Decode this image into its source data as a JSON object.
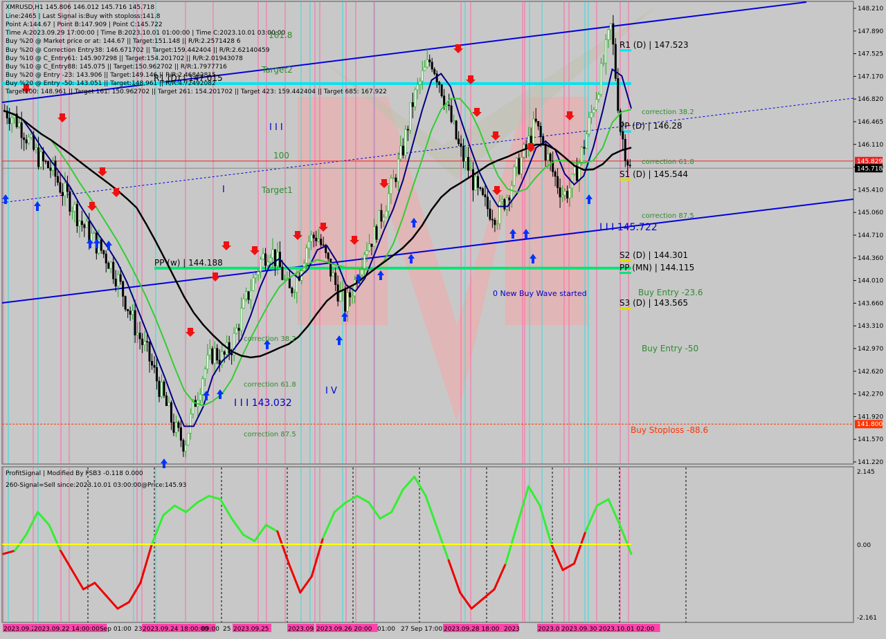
{
  "header": {
    "lines": [
      "XMRUSD,H1  145.806 146.012 145.716 145.718",
      "Line:2465 | Last Signal is:Buy with stoploss:141.8",
      "Point A:144.67 | Point B:147.909 | Point C:145.722",
      "Time A:2023.09.29 17:00:00 | Time B:2023.10.01 01:00:00 | Time C:2023.10.01 03:00:00",
      "Buy %20 @ Market price or at: 144.67 || Target:151.148 || R/R:2.2571428 6",
      "Buy %20 @ Correction Entry38: 146.671702 || Target:159.442404 || R/R:2.62140459",
      "Buy %10 @ C_Entry61: 145.907298 || Target:154.201702 || R/R:2.01943078",
      "Buy %10 @ C_Entry88: 145.075 || Target:150.962702 || R/R:1.7977716",
      "Buy %20 @ Entry -23: 143.906 || Target:149.146 || R/R:2.46842815",
      "Buy %20 @ Entry -50: 143.051 || Target:148.961 || R/R:4.72492082",
      "Target100: 148.961 || Target 161: 150.962702 || Target 261: 154.201702 || Target 423: 159.442404 || Target 685: 167.922"
    ]
  },
  "colors": {
    "background": "#c8c8c8",
    "bull_candle": "#22aa22",
    "trend_channel": "#0000dd",
    "level_cyan": "#00e5ee",
    "pivot_green": "#00e676",
    "ma_fast": "#000080",
    "ma_green": "#33cc33",
    "ma_black": "#000000",
    "stoploss": "#ff3300",
    "osc_up": "#33ee33",
    "osc_down": "#ee0000",
    "zero_line": "#ffff00",
    "vline_magenta": "#ff66aa",
    "vline_cyan": "#33dddd"
  },
  "price_axis": {
    "ticks": [
      "148.210",
      "147.890",
      "147.525",
      "147.170",
      "146.820",
      "146.465",
      "146.110",
      "145.760",
      "145.410",
      "145.060",
      "144.710",
      "144.360",
      "144.010",
      "143.660",
      "143.310",
      "142.970",
      "142.620",
      "142.270",
      "141.920",
      "141.570",
      "141.220"
    ],
    "current_price_label": "145.718",
    "red_line_label": "145.829",
    "stoploss_label": "141.800"
  },
  "annotations": {
    "fib_161": "161.8",
    "target2": "Target2",
    "fib_100": "100",
    "target1": "Target1",
    "wave_iii": "I I I",
    "wave_i": "I",
    "wave_iv": "I V",
    "wave_iii_price": "I I I 143.032",
    "wave_iii_price_2": "I I I 145.722",
    "pp_w": "PP (w) | 144.188",
    "r1_d": "R1 (D) | 147.523",
    "pp_d": "PP (D) | 146.28",
    "s1_d": "S1 (D) | 145.544",
    "s2_d": "S2 (D) | 144.301",
    "pp_mn": "PP (MN) | 144.115",
    "s3_d": "S3 (D) | 143.565",
    "corr_38_top": "correction 38.2",
    "corr_61_top": "correction 61.8",
    "corr_87_top": "correction 87.5",
    "corr_38_bot": "correction 38.2",
    "corr_61_bot": "correction 61.8",
    "corr_87_bot": "correction 87.5",
    "buy_entry_23": "Buy Entry -23.6",
    "buy_entry_50": "Buy Entry -50",
    "buy_stoploss": "Buy Stoploss -88.6",
    "new_wave": "0 New Buy Wave started",
    "r1_short": "R1 (D) | 147.015"
  },
  "oscillator": {
    "title": "ProfitSignal | Modified By FSB3 -0.118 0.000",
    "subtitle": "260-Signal=Sell since:2023.10.01 03:00:00@Price:145.93",
    "axis_top": "2.145",
    "axis_zero": "0.00",
    "axis_bottom": "-2.161"
  },
  "time_axis": {
    "labels": [
      "2023.09.22",
      "2023.09.22 14:00:00",
      "Sep 01:00",
      "23",
      "2023.09.24 18:00:00",
      "09:00",
      "25",
      "2023.09.25",
      "2023.09",
      "2023.09.26 20:00",
      "01:00",
      "27 Sep 17:00",
      "2023.09.28 18:00",
      "2023",
      "2023.0",
      "2023.09.30",
      "2023.10.01 02:00"
    ]
  },
  "chart_data": {
    "type": "candlestick",
    "symbol": "XMRUSD",
    "timeframe": "H1",
    "ohlc_last": {
      "open": 145.806,
      "high": 146.012,
      "low": 145.716,
      "close": 145.718
    },
    "ylim": [
      141.22,
      148.21
    ],
    "close_path": [
      146.6,
      146.5,
      146.3,
      146.0,
      145.8,
      145.7,
      145.4,
      145.2,
      144.9,
      144.7,
      144.5,
      144.3,
      144.0,
      143.6,
      143.2,
      142.9,
      142.5,
      142.1,
      141.7,
      141.5,
      142.1,
      142.6,
      142.9,
      142.8,
      143.0,
      143.5,
      143.9,
      144.3,
      144.5,
      144.2,
      143.8,
      144.1,
      144.6,
      144.7,
      144.3,
      143.9,
      143.6,
      144.0,
      144.5,
      144.7,
      145.1,
      145.5,
      146.0,
      146.7,
      147.1,
      147.4,
      147.0,
      146.5,
      146.0,
      145.7,
      145.3,
      145.1,
      145.0,
      145.3,
      145.7,
      146.0,
      146.4,
      146.0,
      145.6,
      145.3,
      145.5,
      146.0,
      146.6,
      147.2,
      147.9,
      146.3,
      145.7
    ],
    "levels": {
      "r1_d": 147.523,
      "r1_d_short": 147.015,
      "pp_d": 146.28,
      "s1_d": 145.544,
      "s2_d": 144.301,
      "pp_mn": 144.115,
      "s3_d": 143.565,
      "pp_w": 144.188,
      "stoploss": 141.8,
      "red_line": 145.829,
      "target2_line": 147.015
    },
    "oscillator": [
      -0.3,
      -0.2,
      0.3,
      1.0,
      0.6,
      -0.2,
      -0.8,
      -1.4,
      -1.2,
      -1.6,
      -2.0,
      -1.8,
      -1.2,
      0.0,
      0.9,
      1.2,
      1.0,
      1.3,
      1.5,
      1.4,
      0.8,
      0.3,
      0.1,
      0.6,
      0.4,
      -0.6,
      -1.5,
      -1.0,
      0.2,
      1.0,
      1.3,
      1.5,
      1.3,
      0.8,
      1.0,
      1.7,
      2.1,
      1.5,
      0.5,
      -0.5,
      -1.5,
      -2.0,
      -1.7,
      -1.4,
      -0.6,
      0.6,
      1.8,
      1.2,
      0.0,
      -0.8,
      -0.6,
      0.4,
      1.2,
      1.4,
      0.6,
      -0.3
    ]
  }
}
